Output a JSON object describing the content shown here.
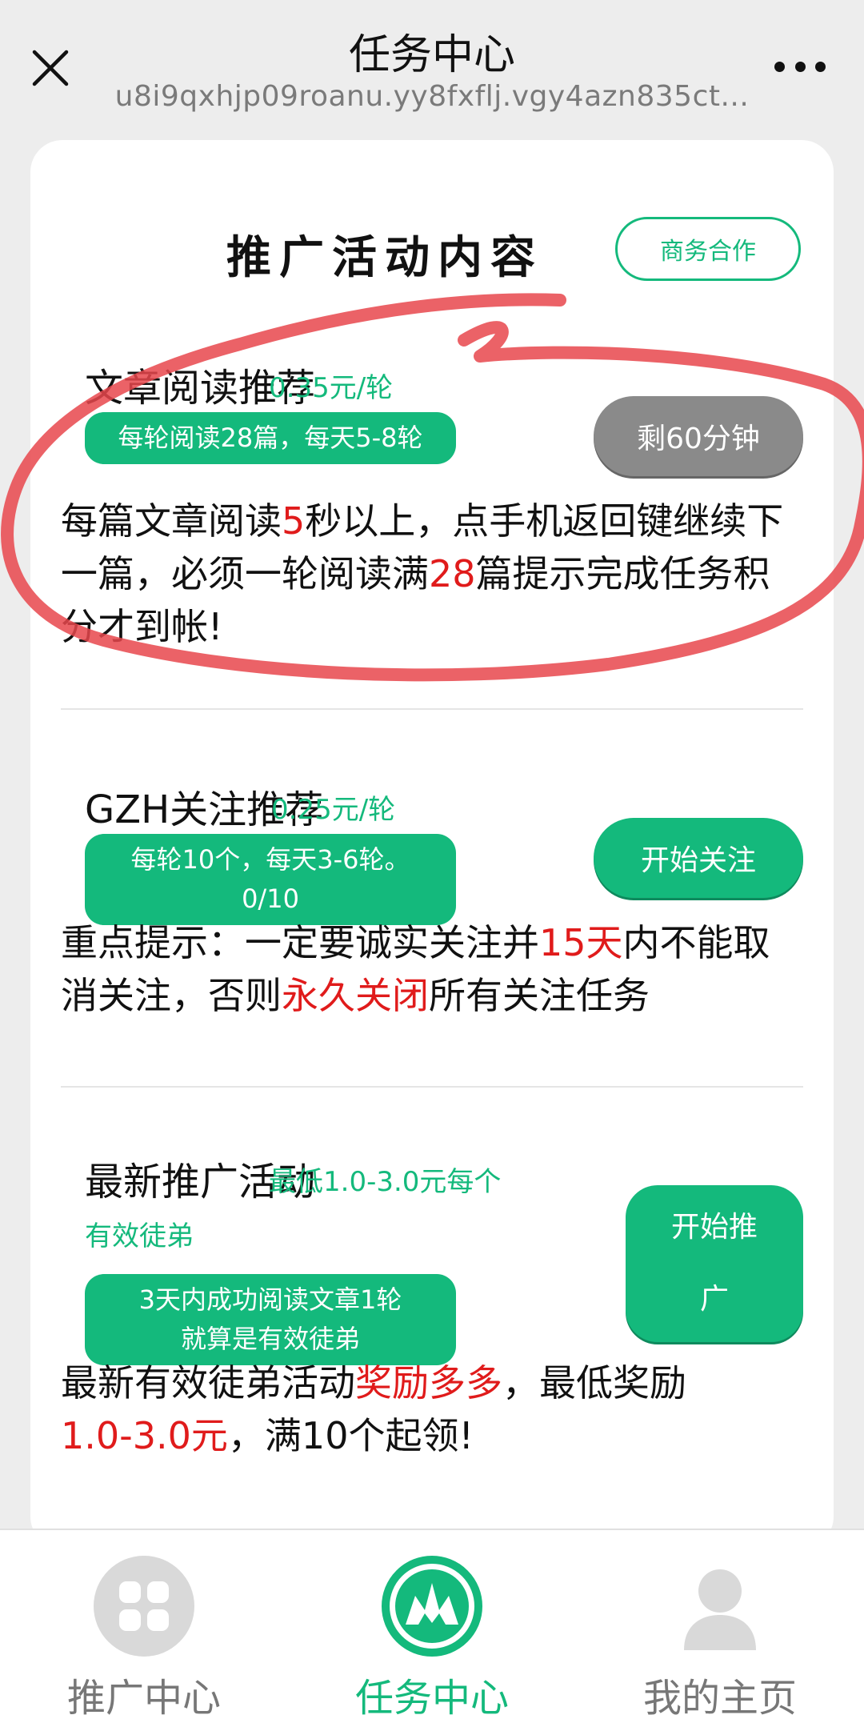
{
  "topbar": {
    "title": "任务中心",
    "url": "u8i9qxhjp09roanu.yy8fxflj.vgy4azn835ct..."
  },
  "card": {
    "title": "推广活动内容",
    "biz_button": "商务合作"
  },
  "sections": [
    {
      "name": "文章阅读推荐",
      "price": "0.35元/轮",
      "chip": "每轮阅读28篇，每天5-8轮",
      "button": "剩60分钟",
      "desc_parts": [
        "每篇文章阅读",
        "5",
        "秒以上，点手机返回键继续下一篇，必须一轮阅读满",
        "28",
        "篇提示完成任务积分才到帐!"
      ]
    },
    {
      "name": "GZH关注推荐",
      "price": "0.25元/轮",
      "chip_line1": "每轮10个，每天3-6轮。",
      "chip_line2": "0/10",
      "button": "开始关注",
      "desc_parts": [
        "重点提示：一定要诚实关注并",
        "15天",
        "内不能取消关注，否则",
        "永久关闭",
        "所有关注任务"
      ]
    },
    {
      "name": "最新推广活动",
      "price_line1": "最低1.0-3.0元每个",
      "price_line2": "有效徒弟",
      "chip_line1": "3天内成功阅读文章1轮",
      "chip_line2": "就算是有效徒弟",
      "button_line1": "开始推",
      "button_line2": "广",
      "desc_parts": [
        "最新有效徒弟活动",
        "奖励多多",
        "，最低奖励",
        "1.0-3.0元",
        "，满10个起领!"
      ]
    }
  ],
  "bottomnav": {
    "items": [
      {
        "label": "推广中心",
        "icon": "grid-apps-icon"
      },
      {
        "label": "任务中心",
        "icon": "flame-icon",
        "active": true
      },
      {
        "label": "我的主页",
        "icon": "user-icon"
      }
    ]
  },
  "colors": {
    "accent": "#14b97c",
    "highlight": "#e01b1b",
    "gray_button": "#8a8a8a",
    "scribble": "#e8474c"
  }
}
